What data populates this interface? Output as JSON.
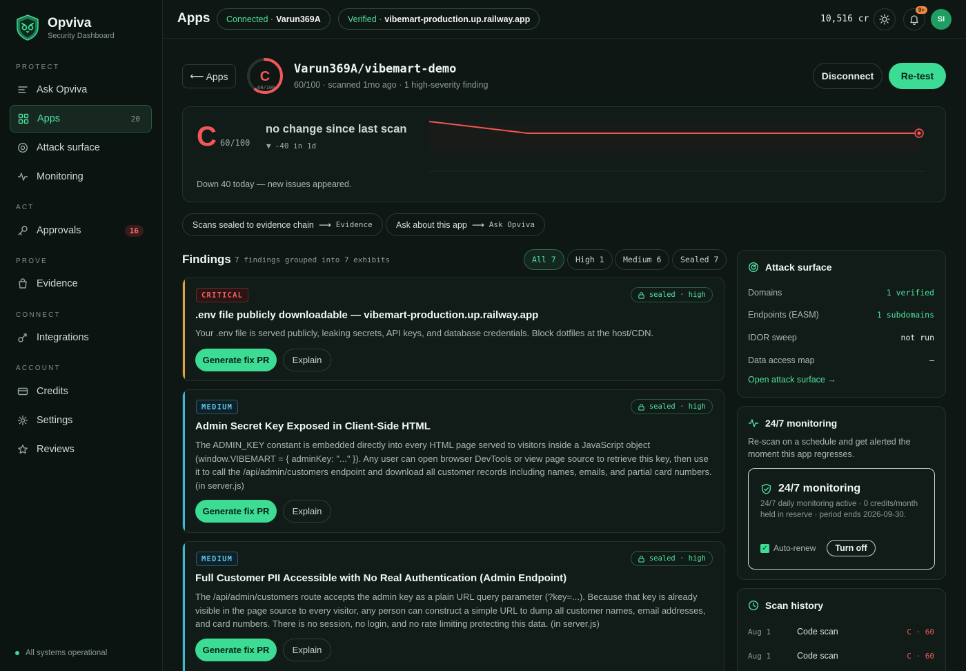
{
  "brand": {
    "name": "Opviva",
    "subtitle": "Security Dashboard"
  },
  "sidebar": {
    "sections": [
      "PROTECT",
      "ACT",
      "PROVE",
      "CONNECT",
      "ACCOUNT"
    ],
    "items": [
      {
        "label": "Ask Opviva",
        "icon": "lines-icon"
      },
      {
        "label": "Apps",
        "icon": "grid-icon",
        "count": "20"
      },
      {
        "label": "Attack surface",
        "icon": "target-icon"
      },
      {
        "label": "Monitoring",
        "icon": "pulse-icon"
      },
      {
        "label": "Approvals",
        "icon": "key-icon",
        "badge": "16"
      },
      {
        "label": "Evidence",
        "icon": "bag-icon"
      },
      {
        "label": "Integrations",
        "icon": "plug-icon"
      },
      {
        "label": "Credits",
        "icon": "card-icon"
      },
      {
        "label": "Settings",
        "icon": "gear-icon"
      },
      {
        "label": "Reviews",
        "icon": "star-icon"
      }
    ],
    "status": "All systems operational"
  },
  "header": {
    "title": "Apps",
    "connected_label": "Connected ·",
    "connected_value": "Varun369A",
    "verified_label": "Verified ·",
    "verified_value": "vibemart-production.up.railway.app",
    "credits": "10,516 cr",
    "notif_count": "9+",
    "avatar": "SI"
  },
  "app": {
    "back_label": "Apps",
    "grade": "C",
    "grade_score": "60/100",
    "repo": "Varun369A/vibemart-demo",
    "meta": "60/100 · scanned 1mo ago · 1 high-severity finding",
    "disconnect_label": "Disconnect",
    "retest_label": "Re-test"
  },
  "score": {
    "letter": "C",
    "value": "60/100",
    "message": "no change since last scan",
    "delta": "-40 in 1d",
    "note": "Down 40 today — new issues appeared.",
    "colors": {
      "line": "#f25757"
    }
  },
  "chips": [
    {
      "label": "Scans sealed to evidence chain",
      "target": "Evidence"
    },
    {
      "label": "Ask about this app",
      "target": "Ask Opviva"
    }
  ],
  "findings": {
    "title": "Findings",
    "subtitle": "7 findings grouped into 7 exhibits",
    "filters": [
      "All 7",
      "High 1",
      "Medium 6",
      "Sealed 7"
    ],
    "items": [
      {
        "severity": "CRITICAL",
        "sealed": "sealed · high",
        "title": ".env file publicly downloadable — vibemart-production.up.railway.app",
        "description": "Your .env file is served publicly, leaking secrets, API keys, and database credentials. Block dotfiles at the host/CDN.",
        "fix_label": "Generate fix PR",
        "explain_label": "Explain"
      },
      {
        "severity": "MEDIUM",
        "sealed": "sealed · high",
        "title": "Admin Secret Key Exposed in Client-Side HTML",
        "description": "The ADMIN_KEY constant is embedded directly into every HTML page served to visitors inside a JavaScript object (window.VIBEMART = { adminKey: \"...\" }). Any user can open browser DevTools or view page source to retrieve this key, then use it to call the /api/admin/customers endpoint and download all customer records including names, emails, and partial card numbers. (in server.js)",
        "fix_label": "Generate fix PR",
        "explain_label": "Explain"
      },
      {
        "severity": "MEDIUM",
        "sealed": "sealed · high",
        "title": "Full Customer PII Accessible with No Real Authentication (Admin Endpoint)",
        "description": "The /api/admin/customers route accepts the admin key as a plain URL query parameter (?key=...). Because that key is already visible in the page source to every visitor, any person can construct a simple URL to dump all customer names, email addresses, and card numbers. There is no session, no login, and no rate limiting protecting this data. (in server.js)",
        "fix_label": "Generate fix PR",
        "explain_label": "Explain"
      }
    ]
  },
  "attack_surface": {
    "title": "Attack surface",
    "rows": [
      {
        "label": "Domains",
        "value": "1 verified",
        "color": "#4fe0a0"
      },
      {
        "label": "Endpoints (EASM)",
        "value": "1 subdomains",
        "color": "#4fe0a0"
      },
      {
        "label": "IDOR sweep",
        "value": "not run",
        "color": "#e6ece9"
      },
      {
        "label": "Data access map",
        "value": "–",
        "color": "#e6ece9"
      }
    ],
    "link": "Open attack surface →"
  },
  "monitoring": {
    "title": "24/7 monitoring",
    "description": "Re-scan on a schedule and get alerted the moment this app regresses.",
    "box_title": "24/7 monitoring",
    "box_text": "24/7 daily monitoring active · 0 credits/month held in reserve · period ends 2026-09-30.",
    "autorenew_label": "Auto-renew",
    "turnoff_label": "Turn off"
  },
  "scan_history": {
    "title": "Scan history",
    "rows": [
      {
        "date": "Aug 1",
        "type": "Code scan",
        "score": "C · 60"
      },
      {
        "date": "Aug 1",
        "type": "Code scan",
        "score": "C · 60"
      }
    ]
  }
}
